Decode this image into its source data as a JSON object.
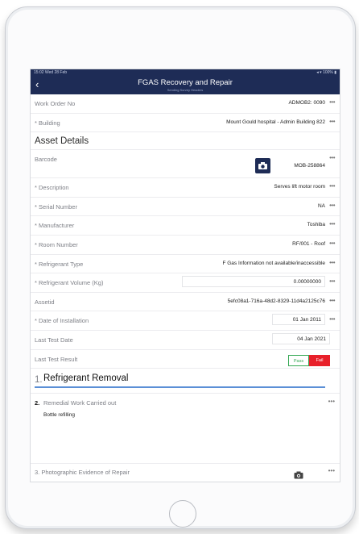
{
  "status_bar": {
    "left": "15:02  Wed 28 Feb",
    "right": "◂ ▾ 100% ▮"
  },
  "nav": {
    "back": "‹",
    "title": "FGAS Recovery and Repair",
    "subtitle": "Sending Survey Headers"
  },
  "header_fields": [
    {
      "label": "Work Order No",
      "value": "ADMOB2: 0090",
      "required": false
    },
    {
      "label": "Building",
      "value": "Mount Gould hospital - Admin Building 822",
      "required": true
    }
  ],
  "asset_details_title": "Asset Details",
  "barcode": {
    "label": "Barcode",
    "value": "MOB-258864"
  },
  "asset_fields": [
    {
      "label": "Description",
      "value": "Serves lift motor room",
      "required": true
    },
    {
      "label": "Serial Number",
      "value": "NA",
      "required": true
    },
    {
      "label": "Manufacturer",
      "value": "Toshiba",
      "required": true
    },
    {
      "label": "Room Number",
      "value": "RF/001 - Roof",
      "required": true
    },
    {
      "label": "Refrigerant Type",
      "value": "F Gas Information not available/inaccessible",
      "required": true
    }
  ],
  "refrigerant_volume": {
    "label": "Refrigerant Volume (Kg)",
    "value": "0.00000000",
    "required": true
  },
  "asset_id": {
    "label": "Assetid",
    "value": "5efc08a1-716a-48d2-8329-11d4a2125c76"
  },
  "install_date": {
    "label": "Date of Installation",
    "value": "01 Jan 2011",
    "required": true
  },
  "last_test_date": {
    "label": "Last Test Date",
    "value": "04 Jan 2021"
  },
  "last_test_result": {
    "label": "Last Test Result",
    "pass": "Pass",
    "fail": "Fail"
  },
  "removal": {
    "number": "1.",
    "title": "Refrigerant Removal"
  },
  "remedial": {
    "number": "2.",
    "label": "Remedial Work Carried out",
    "value": "Bottle refilling"
  },
  "photo": {
    "number": "3.",
    "label": "Photographic Evidence of Repair"
  },
  "more_icon": "•••",
  "required_marker": "*",
  "colors": {
    "nav": "#1e2c56",
    "pass": "#34a853",
    "fail": "#e8202a",
    "accent": "#5b8fd6"
  }
}
